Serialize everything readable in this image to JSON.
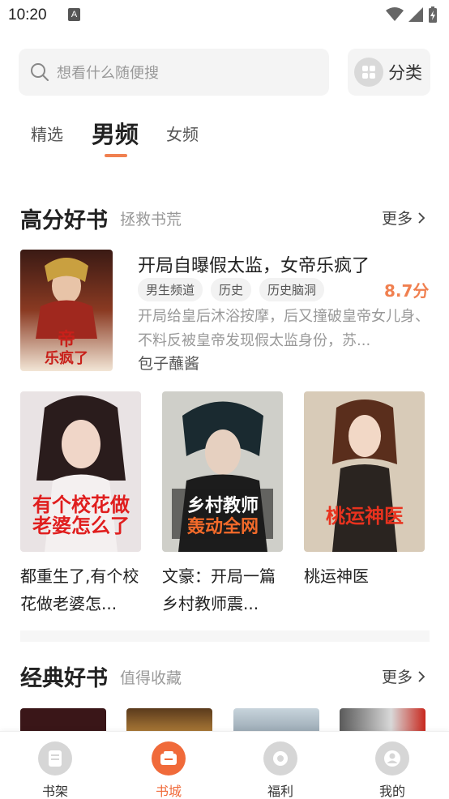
{
  "status": {
    "time": "10:20",
    "notify_letter": "A"
  },
  "search": {
    "placeholder": "想看什么随便搜"
  },
  "category_button": {
    "label": "分类"
  },
  "tabs": [
    {
      "label": "精选"
    },
    {
      "label": "男频"
    },
    {
      "label": "女频"
    }
  ],
  "section_high": {
    "title": "高分好书",
    "subtitle": "拯救书荒",
    "more": "更多"
  },
  "featured_book": {
    "title": "开局自曝假太监，女帝乐疯了",
    "tags": [
      "男生频道",
      "历史",
      "历史脑洞"
    ],
    "score": "8.7分",
    "description": "开局给皇后沐浴按摩，后又撞破皇帝女儿身、不料反被皇帝发现假太监身份，苏...",
    "author": "包子蘸酱"
  },
  "grid_books": [
    {
      "title": "都重生了,有个校花做老婆怎..."
    },
    {
      "title": "文豪：开局一篇乡村教师震..."
    },
    {
      "title": "桃运神医"
    }
  ],
  "section_classic": {
    "title": "经典好书",
    "subtitle": "值得收藏",
    "more": "更多"
  },
  "bottom_nav": [
    {
      "label": "书架"
    },
    {
      "label": "书城"
    },
    {
      "label": "福利"
    },
    {
      "label": "我的"
    }
  ],
  "colors": {
    "accent": "#f06a3a",
    "score": "#f08050",
    "muted": "#999999"
  }
}
